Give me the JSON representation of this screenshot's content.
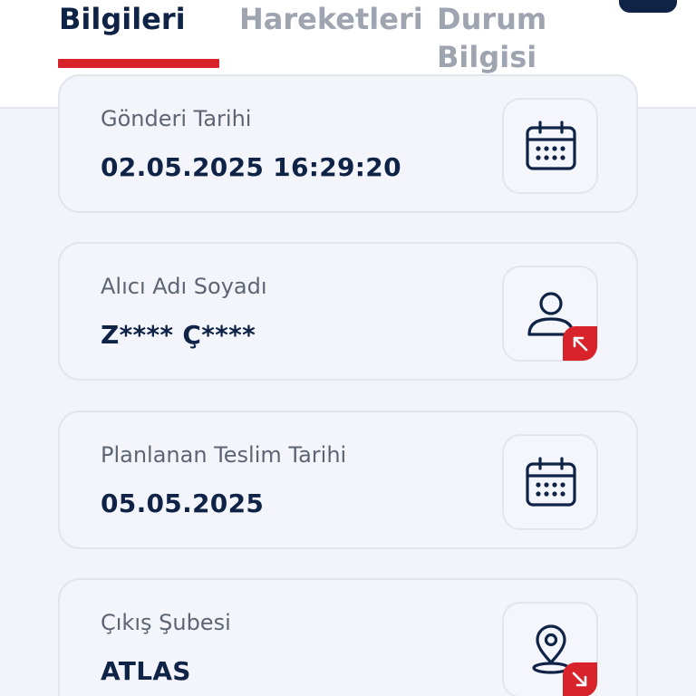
{
  "tabs": [
    {
      "label": "Bilgileri",
      "active": true
    },
    {
      "label": "Hareketleri",
      "active": false
    },
    {
      "label": "Durum Bilgisi",
      "active": false
    }
  ],
  "cards": [
    {
      "label": "Gönderi Tarihi",
      "value": "02.05.2025 16:29:20",
      "icon": "calendar-icon"
    },
    {
      "label": "Alıcı Adı Soyadı",
      "value": "Z**** Ç****",
      "icon": "user-icon",
      "badge": "arrow-up-left-icon"
    },
    {
      "label": "Planlanan Teslim Tarihi",
      "value": "05.05.2025",
      "icon": "calendar-icon"
    },
    {
      "label": "Çıkış Şubesi",
      "value": "ATLAS",
      "icon": "location-pin-icon",
      "badge": "arrow-down-right-icon"
    }
  ],
  "colors": {
    "accent": "#d8232a",
    "navy": "#0f2346",
    "muted": "#9ea5b0",
    "background": "#f1f4fa"
  }
}
